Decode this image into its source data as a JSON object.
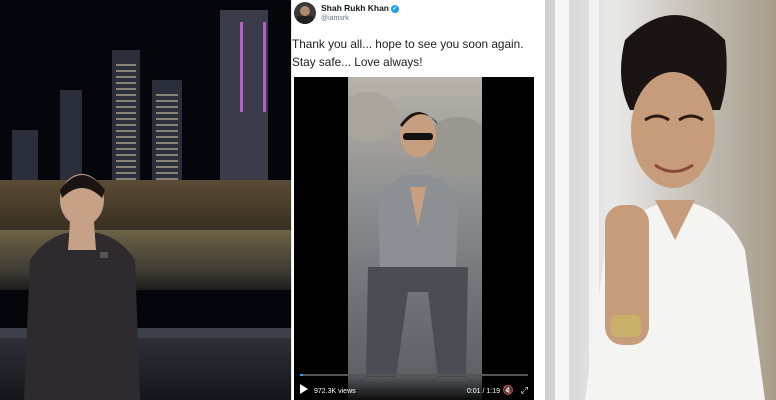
{
  "tweet": {
    "name": "Shah Rukh Khan",
    "handle": "@iamsrk",
    "text": "Thank you all... hope to see you soon again. Stay safe... Love always!"
  },
  "video": {
    "views": "972.3K views",
    "time": "0:01 / 1:19",
    "progress": 0.013
  },
  "icons": {
    "play": "play-icon",
    "volume": "volume-icon",
    "fullscreen": "fullscreen-icon",
    "verified": "verified-badge-icon"
  },
  "colors": {
    "twitter_blue": "#1da1f2"
  }
}
